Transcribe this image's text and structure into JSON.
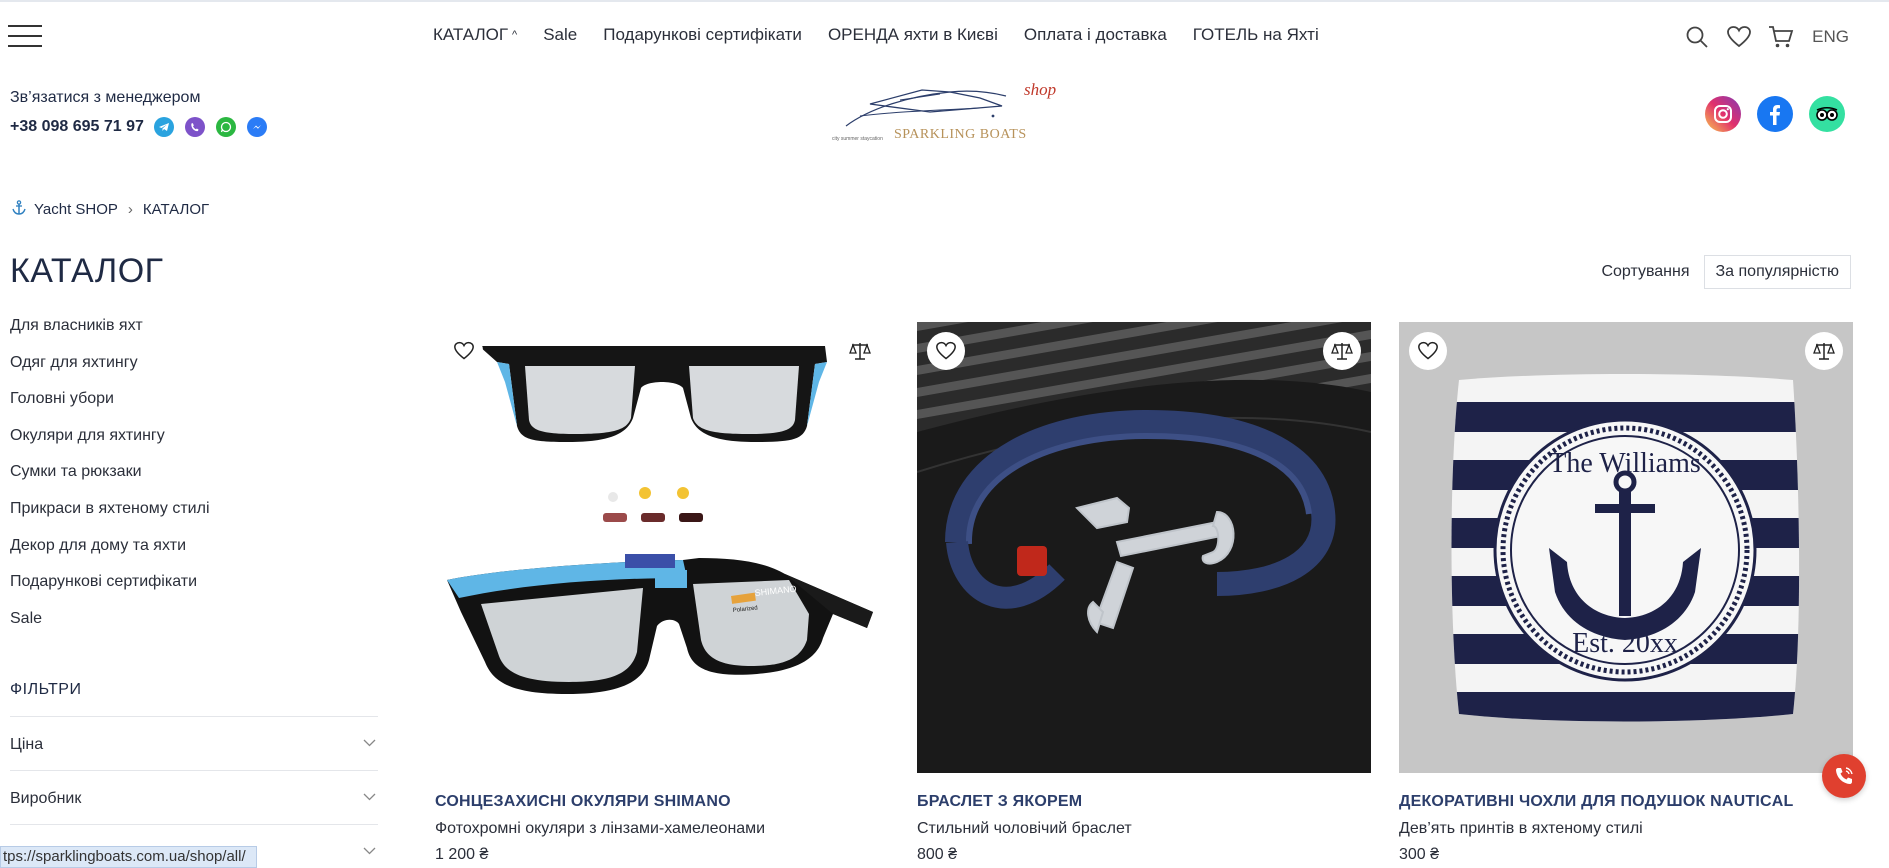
{
  "nav": {
    "items": [
      {
        "label": "КАТАЛОГ"
      },
      {
        "label": "Sale"
      },
      {
        "label": "Подарункові сертифікати"
      },
      {
        "label": "ОРЕНДА яхти в Києві"
      },
      {
        "label": "Оплата і доставка"
      },
      {
        "label": "ГОТЕЛЬ на Яхті"
      }
    ],
    "lang": "ENG"
  },
  "contact": {
    "label": "Зв’язатися з менеджером",
    "phone": "+38 098 695 71 97"
  },
  "logo": {
    "shop": "shop",
    "brand": "SPARKLING BOATS",
    "tagline": "city summer staycation"
  },
  "breadcrumb": {
    "home": "Yacht SHOP",
    "current": "КАТАЛОГ"
  },
  "page": {
    "title": "КАТАЛОГ"
  },
  "categories": [
    "Для власників яхт",
    "Одяг для яхтингу",
    "Головні убори",
    "Окуляри для яхтингу",
    "Сумки та рюкзаки",
    "Прикраси в яхтеному стилі",
    "Декор для дому та яхти",
    "Подарункові сертифікати",
    "Sale"
  ],
  "filters": {
    "title": "ФІЛЬТРИ",
    "items": [
      "Ціна",
      "Виробник",
      ""
    ]
  },
  "sort": {
    "label": "Сортування",
    "value": "За популярністю"
  },
  "products": [
    {
      "title": "СОНЦЕЗАХИСНІ ОКУЛЯРИ SHIMANO",
      "desc": "Фотохромні окуляри з лінзами-хамелеонами",
      "price": "1 200 ₴",
      "brand_text": "SHIMANO",
      "badge_text": "Polarized"
    },
    {
      "title": "БРАСЛЕТ З ЯКОРЕМ",
      "desc": "Стильний чоловічий браслет",
      "price": "800 ₴"
    },
    {
      "title": "ДЕКОРАТИВНІ ЧОХЛИ ДЛЯ ПОДУШОК NAUTICAL",
      "desc": "Дев’ять принтів в яхтеному стилі",
      "price": "300 ₴",
      "print_top": "The Williams",
      "print_bottom": "Est. 20xx"
    }
  ],
  "status_url": "tps://sparklingboats.com.ua/shop/all/",
  "colors": {
    "accent_dark": "#1f2a44",
    "product_title": "#2c3e6b",
    "call_button": "#e0402f",
    "telegram": "#2aa3df",
    "viber": "#7d52c9",
    "whatsapp": "#2bb741",
    "messenger": "#2b7cf6",
    "facebook": "#1877f2",
    "tripadvisor": "#34e0a1"
  }
}
